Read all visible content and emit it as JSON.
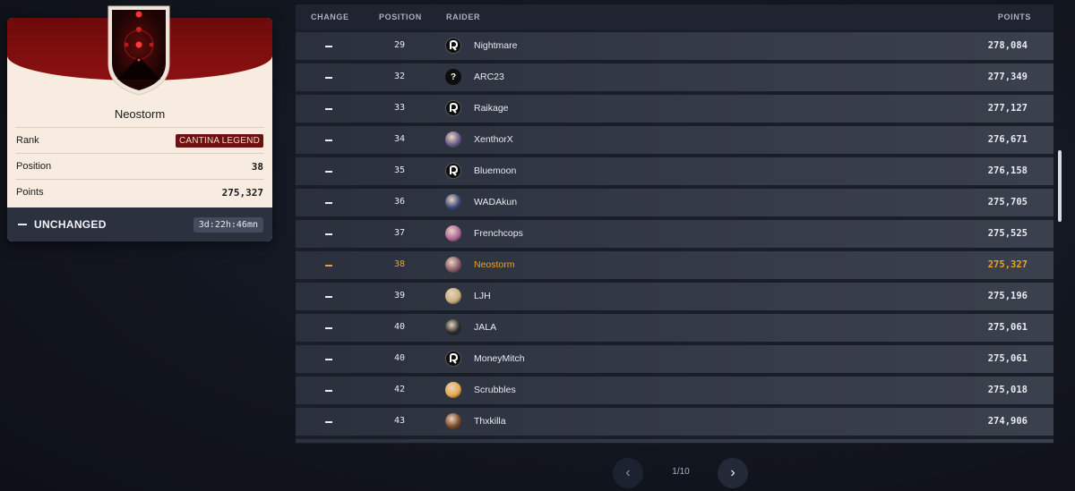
{
  "profile": {
    "name": "Neostorm",
    "rank_label": "Rank",
    "rank_value": "CANTINA LEGEND",
    "position_label": "Position",
    "position_value": "38",
    "points_label": "Points",
    "points_value": "275,327",
    "status": "UNCHANGED",
    "timer": "3d:22h:46mn"
  },
  "table": {
    "headers": {
      "change": "CHANGE",
      "position": "POSITION",
      "raider": "RAIDER",
      "points": "POINTS"
    },
    "rows": [
      {
        "position": "29",
        "raider": "Nightmare",
        "points": "278,084",
        "avatar": "logo-icon"
      },
      {
        "position": "32",
        "raider": "ARC23",
        "points": "277,349",
        "avatar": "question-icon"
      },
      {
        "position": "33",
        "raider": "Raikage",
        "points": "277,127",
        "avatar": "logo-icon"
      },
      {
        "position": "34",
        "raider": "XenthorX",
        "points": "276,671",
        "avatar": "photo-avatar"
      },
      {
        "position": "35",
        "raider": "Bluemoon",
        "points": "276,158",
        "avatar": "logo-icon"
      },
      {
        "position": "36",
        "raider": "WADAkun",
        "points": "275,705",
        "avatar": "photo-avatar"
      },
      {
        "position": "37",
        "raider": "Frenchcops",
        "points": "275,525",
        "avatar": "photo-avatar"
      },
      {
        "position": "38",
        "raider": "Neostorm",
        "points": "275,327",
        "avatar": "photo-avatar",
        "highlight": true
      },
      {
        "position": "39",
        "raider": "LJH",
        "points": "275,196",
        "avatar": "photo-avatar"
      },
      {
        "position": "40",
        "raider": "JALA",
        "points": "275,061",
        "avatar": "photo-avatar"
      },
      {
        "position": "40",
        "raider": "MoneyMitch",
        "points": "275,061",
        "avatar": "logo-icon"
      },
      {
        "position": "42",
        "raider": "Scrubbles",
        "points": "275,018",
        "avatar": "photo-avatar"
      },
      {
        "position": "43",
        "raider": "Thxkilla",
        "points": "274,906",
        "avatar": "photo-avatar"
      }
    ]
  },
  "pagination": {
    "indicator": "1/10",
    "prev_icon": "chevron-left-icon",
    "next_icon": "chevron-right-icon"
  },
  "colors": {
    "highlight": "#e9a32b",
    "badge": "#6d1010",
    "card_bg": "#f7ecdf"
  }
}
